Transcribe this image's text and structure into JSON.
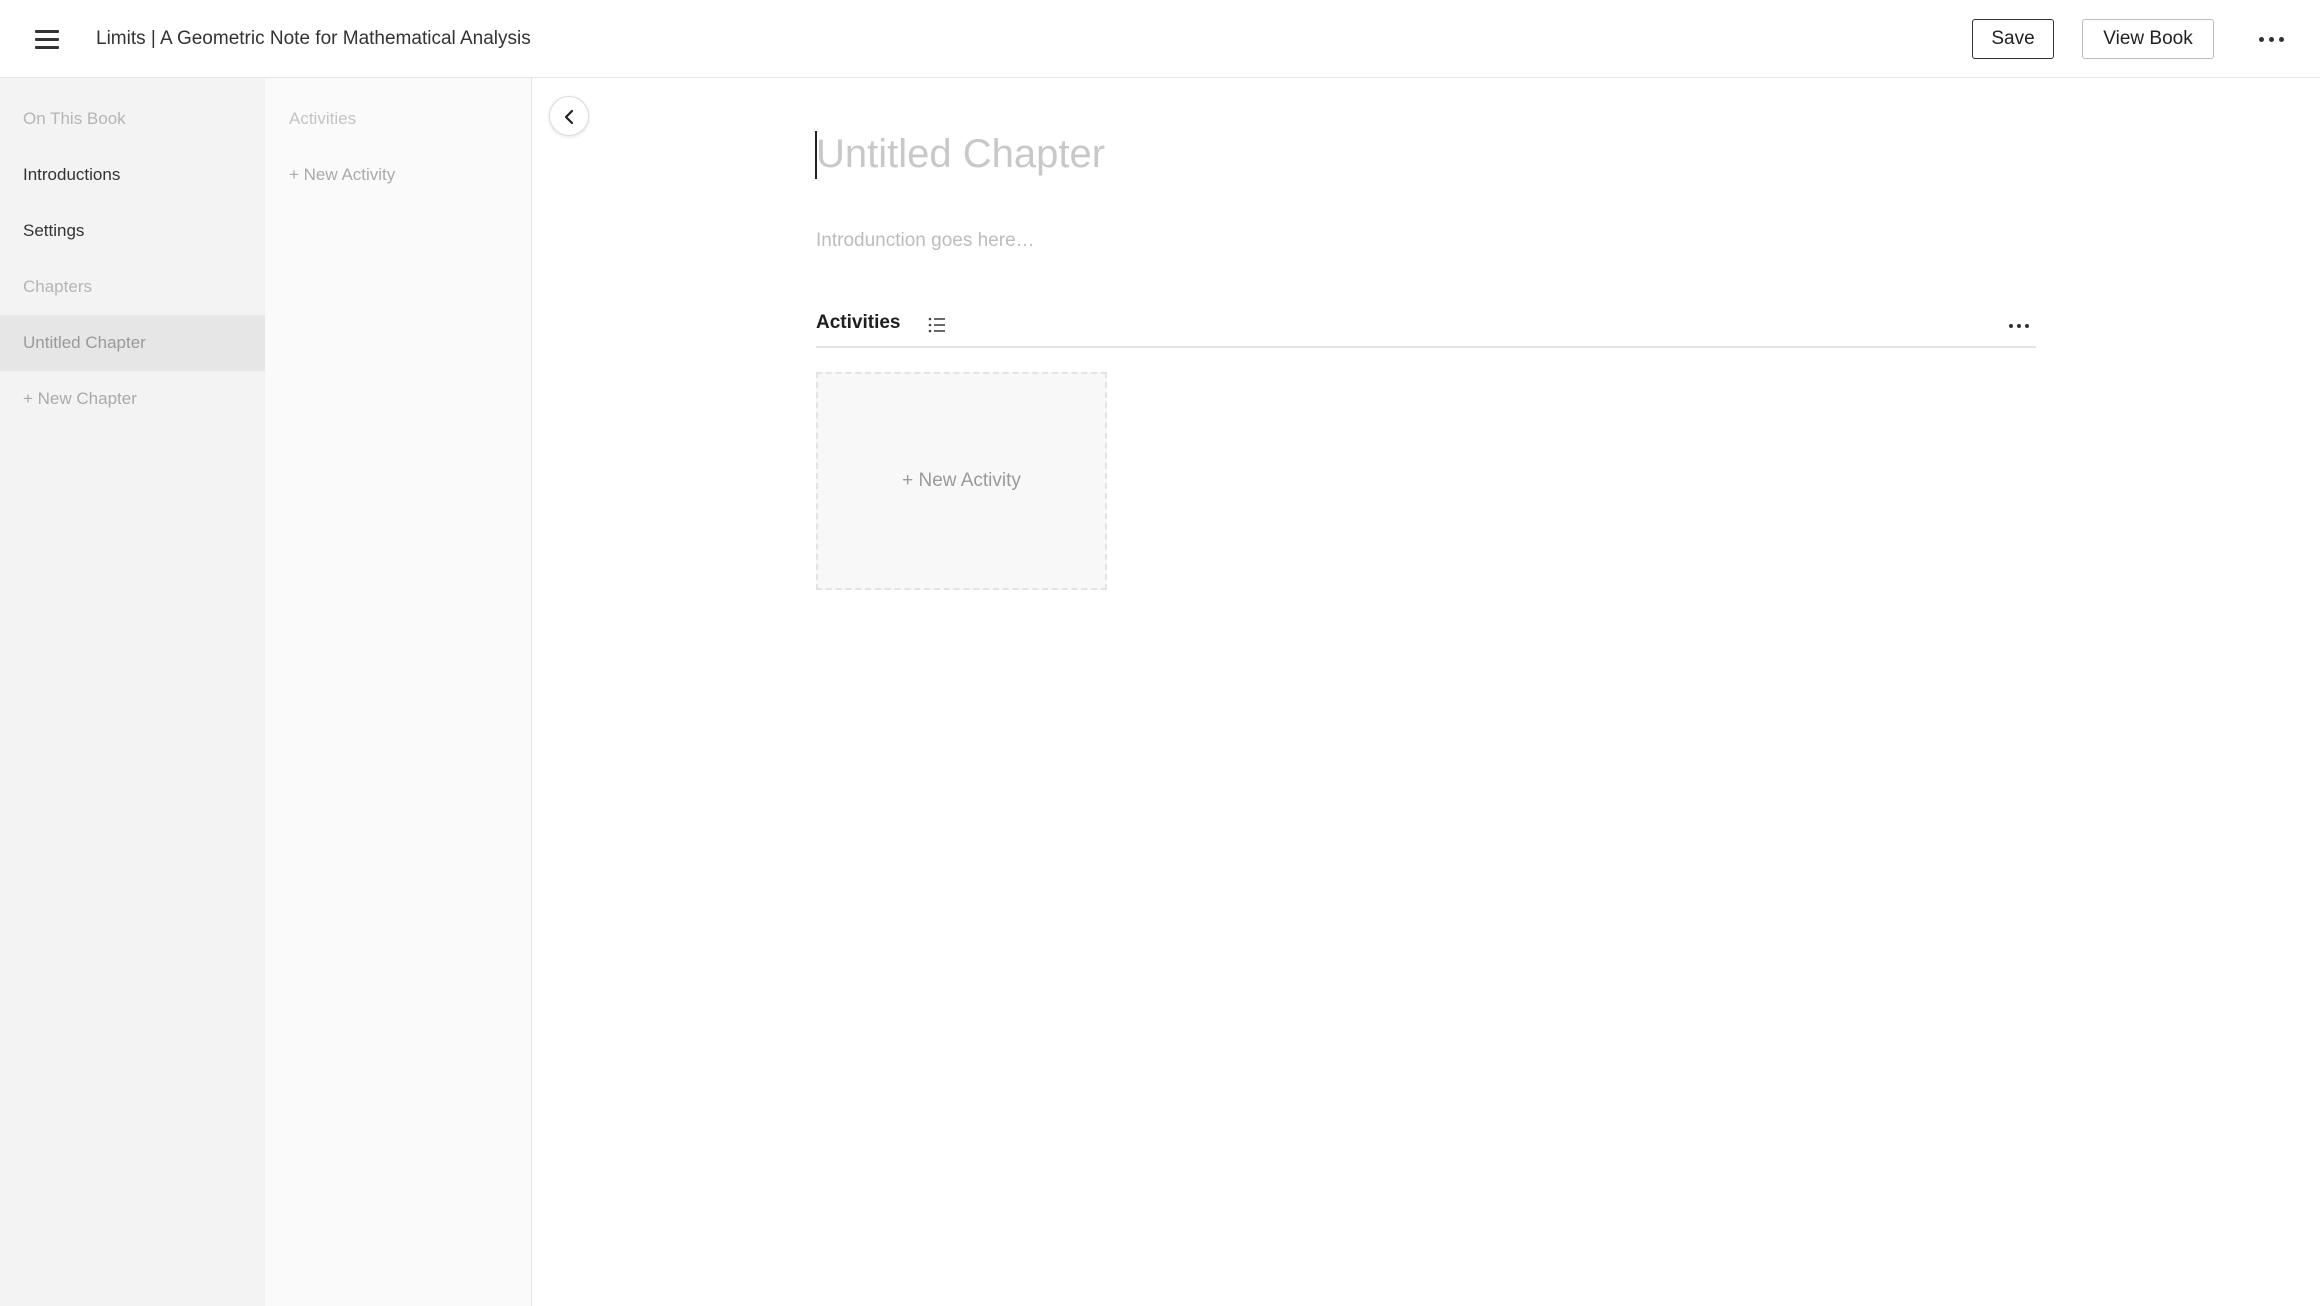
{
  "header": {
    "book_title": "Limits | A Geometric Note for Mathematical Analysis",
    "save_label": "Save",
    "view_book_label": "View Book"
  },
  "sidebar": {
    "section_book": "On This Book",
    "items": [
      {
        "label": "Introductions"
      },
      {
        "label": "Settings"
      }
    ],
    "section_chapters": "Chapters",
    "chapters": [
      {
        "label": "Untitled Chapter",
        "active": true
      }
    ],
    "new_chapter_label": "+ New Chapter"
  },
  "activities_panel": {
    "heading": "Activities",
    "new_activity_label": "+ New Activity"
  },
  "main": {
    "chapter_title_value": "",
    "chapter_title_placeholder": "Untitled Chapter",
    "intro_value": "",
    "intro_placeholder": "Introdunction goes here…",
    "activities_heading": "Activities",
    "new_activity_card_label": "+ New Activity"
  },
  "icons": {
    "menu": "hamburger-menu-icon",
    "more": "more-horizontal-icon",
    "collapse": "chevron-left-icon",
    "list": "list-icon"
  },
  "colors": {
    "sidebar_bg": "#f3f3f3",
    "active_item_bg": "#e6e6e6",
    "muted_text": "#b5b5b5",
    "text": "#333333"
  }
}
